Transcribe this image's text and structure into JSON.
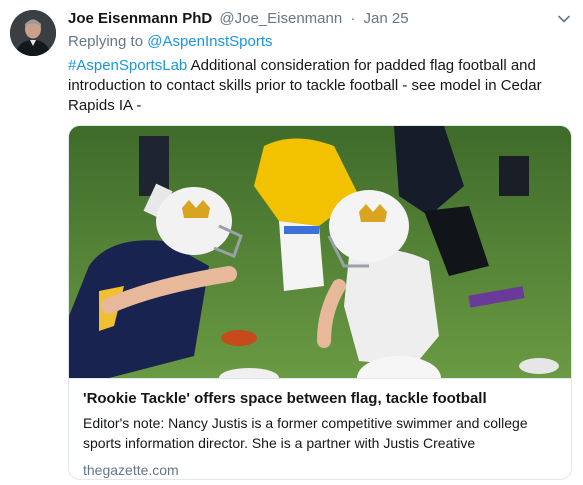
{
  "tweet": {
    "author_name": "Joe Eisenmann PhD",
    "author_handle": "@Joe_Eisenmann",
    "separator": "·",
    "timestamp": "Jan 25",
    "replying_prefix": "Replying to",
    "replying_to": "@AspenInstSports",
    "hashtag": "#AspenSportsLab",
    "body": "Additional consideration for padded flag football and introduction to contact skills prior to tackle football - see model in Cedar Rapids IA -"
  },
  "card": {
    "title": "'Rookie Tackle' offers space between flag, tackle football",
    "description": "Editor's note: Nancy Justis is a former competitive swimmer and college sports information director. She is a partner with Justis Creative",
    "domain": "thegazette.com",
    "image_subject": "youth-football-players-photo"
  },
  "colors": {
    "link": "#1b95e0",
    "muted": "#657786",
    "text": "#14171a",
    "border": "#e1e8ed"
  },
  "icons": {
    "more": "chevron-down-icon"
  }
}
